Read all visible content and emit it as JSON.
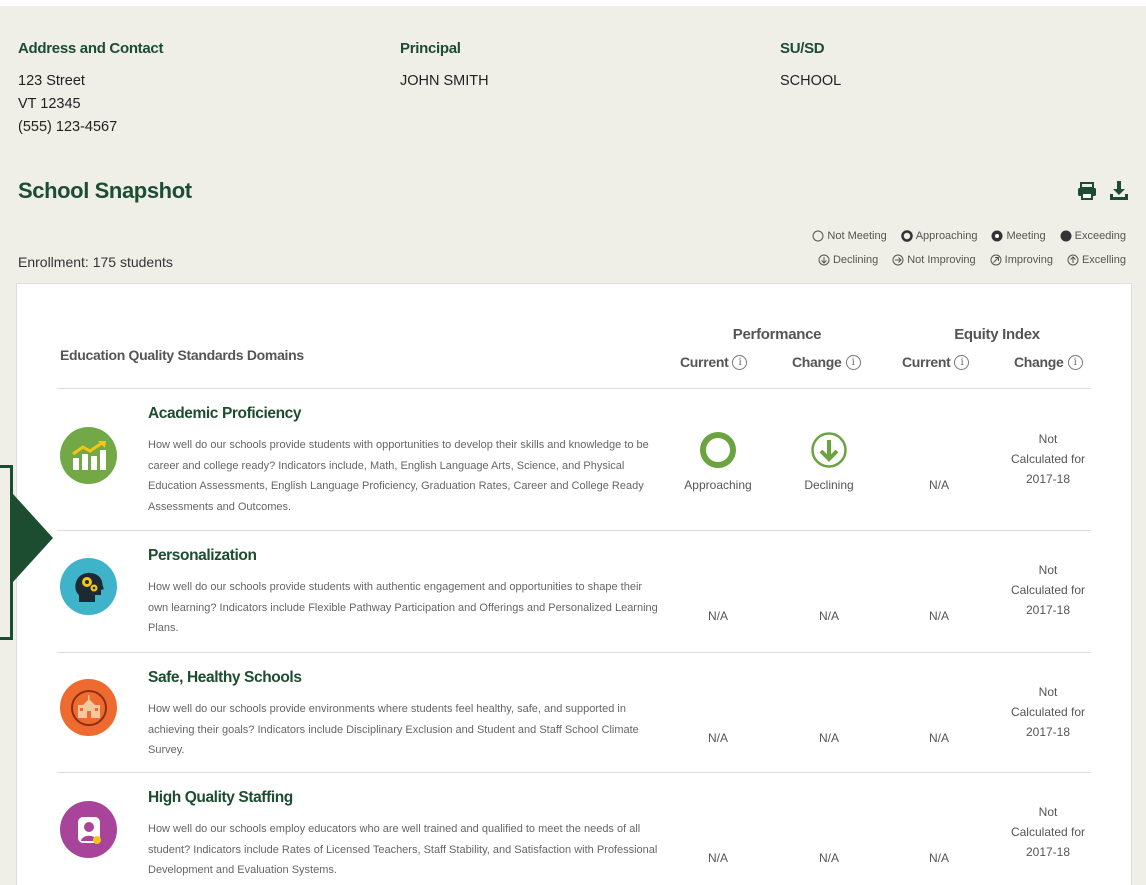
{
  "contact": {
    "address": {
      "heading": "Address and Contact",
      "lines": [
        "123 Street",
        "VT 12345",
        "(555) 123-4567"
      ]
    },
    "principal": {
      "heading": "Principal",
      "name": "JOHN SMITH"
    },
    "susd": {
      "heading": "SU/SD",
      "value": "SCHOOL"
    }
  },
  "snapshot": {
    "title": "School Snapshot",
    "enrollment": "Enrollment: 175 students",
    "tools": [
      "print-icon",
      "download-icon"
    ]
  },
  "legend": {
    "performance": [
      "Not Meeting",
      "Approaching",
      "Meeting",
      "Exceeding"
    ],
    "change": [
      "Declining",
      "Not Improving",
      "Improving",
      "Excelling"
    ]
  },
  "table": {
    "domains_header": "Education Quality Standards Domains",
    "performance_header": "Performance",
    "equity_header": "Equity Index",
    "current_label": "Current",
    "change_label": "Change",
    "info_glyph": "i",
    "rows": [
      {
        "name": "Academic Proficiency",
        "description": "How well do our schools provide students with opportunities to develop their skills and knowledge to be career and college ready? Indicators include, Math, English Language Arts, Science, and Physical Education Assessments, English Language Proficiency, Graduation Rates, Career and College Ready Assessments and Outcomes.",
        "icon": "chart-growth-icon",
        "color": "#72a845",
        "perf_current": "Approaching",
        "perf_change": "Declining",
        "equity_current": "N/A",
        "equity_change": [
          "Not",
          "Calculated for",
          "2017-18"
        ]
      },
      {
        "name": "Personalization",
        "description": "How well do our schools provide students with authentic engagement and opportunities to shape their own learning? Indicators include Flexible Pathway Participation and Offerings and Personalized Learning Plans.",
        "icon": "head-gears-icon",
        "color": "#3fb3c9",
        "perf_current": "N/A",
        "perf_change": "N/A",
        "equity_current": "N/A",
        "equity_change": [
          "Not",
          "Calculated for",
          "2017-18"
        ]
      },
      {
        "name": "Safe, Healthy Schools",
        "description": "How well do our schools provide environments where students feel healthy, safe, and supported in achieving their goals? Indicators include Disciplinary Exclusion and Student and Staff School Climate Survey.",
        "icon": "school-building-icon",
        "color": "#ef6a2e",
        "perf_current": "N/A",
        "perf_change": "N/A",
        "equity_current": "N/A",
        "equity_change": [
          "Not",
          "Calculated for",
          "2017-18"
        ]
      },
      {
        "name": "High Quality Staffing",
        "description": "How well do our schools employ educators who are well trained and qualified to meet the needs of all student? Indicators include Rates of Licensed Teachers, Staff Stability, and Satisfaction with Professional Development and Evaluation Systems.",
        "icon": "educator-icon",
        "color": "#a8449a",
        "perf_current": "N/A",
        "perf_change": "N/A",
        "equity_current": "N/A",
        "equity_change": [
          "Not",
          "Calculated for",
          "2017-18"
        ]
      }
    ]
  },
  "colors": {
    "brand_green": "#1d4d30",
    "status_green": "#6aa33f"
  }
}
